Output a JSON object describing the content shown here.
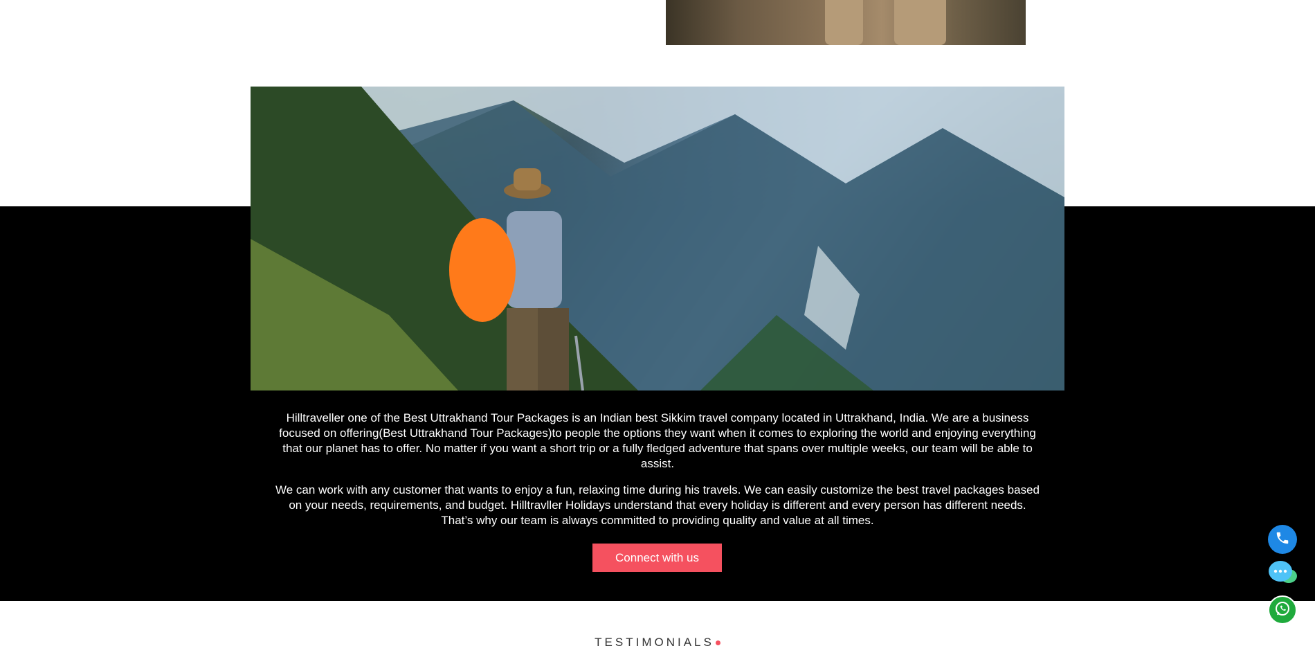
{
  "about": {
    "paragraph1": "Hilltraveller one of the Best Uttrakhand Tour Packages is an Indian best Sikkim travel company located in Uttrakhand, India. We are a business focused on offering(Best Uttrakhand Tour Packages)to people the options they want when it comes to exploring the world and enjoying everything that our planet has to offer. No matter if you want a short trip or a fully fledged adventure that spans over multiple weeks, our team will be able to assist.",
    "paragraph2": "We can work with any customer that wants to enjoy a fun, relaxing time during his travels. We can easily customize the best travel packages based on your needs, requirements, and budget. Hilltravller Holidays understand that every holiday is different and every person has different needs. That’s why our team is always committed to providing quality and value at all times.",
    "cta_label": "Connect with us"
  },
  "testimonials": {
    "heading": "TESTIMONIALS"
  },
  "floating_actions": [
    {
      "icon": "phone-icon",
      "color": "#1e88e5"
    },
    {
      "icon": "chat-bubbles-icon",
      "color": "#4fc3f7"
    },
    {
      "icon": "whatsapp-icon",
      "color": "#1faa3c"
    }
  ],
  "colors": {
    "accent": "#f5515f",
    "band": "#000000"
  }
}
